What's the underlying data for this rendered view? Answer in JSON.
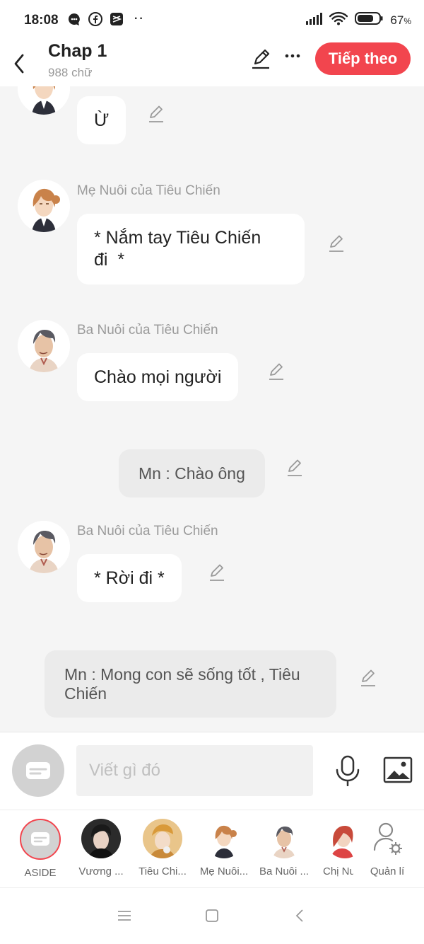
{
  "status": {
    "time": "18:08",
    "dots": "··",
    "battery": "67"
  },
  "header": {
    "title": "Chap 1",
    "word_count": "988 chữ",
    "next_label": "Tiếp theo"
  },
  "messages": [
    {
      "type": "char",
      "speaker": "",
      "text": "Ừ"
    },
    {
      "type": "char",
      "speaker": "Mẹ Nuôi của Tiêu Chiến",
      "line1": "* Nắm tay Tiêu Chiến",
      "line2": "đi  *"
    },
    {
      "type": "char",
      "speaker": "Ba Nuôi của Tiêu Chiến",
      "text": "Chào mọi người"
    },
    {
      "type": "narration",
      "text": "Mn : Chào ông"
    },
    {
      "type": "char",
      "speaker": "Ba Nuôi của Tiêu Chiến",
      "text": "* Rời đi *"
    },
    {
      "type": "narration",
      "line1": "Mn : Mong con sẽ sống tốt , Tiêu",
      "line2": "Chiến"
    }
  ],
  "input": {
    "placeholder": "Viết gì đó"
  },
  "characters": [
    {
      "name": "ASIDE"
    },
    {
      "name": "Vương ..."
    },
    {
      "name": "Tiêu Chi..."
    },
    {
      "name": "Mẹ Nuôi..."
    },
    {
      "name": "Ba Nuôi ..."
    },
    {
      "name": "Chị Nu"
    },
    {
      "name": "Quản lí"
    }
  ],
  "colors": {
    "accent": "#f2454e",
    "bubble": "#ffffff",
    "narration_bg": "#ebebeb",
    "page_bg": "#f5f5f5"
  }
}
